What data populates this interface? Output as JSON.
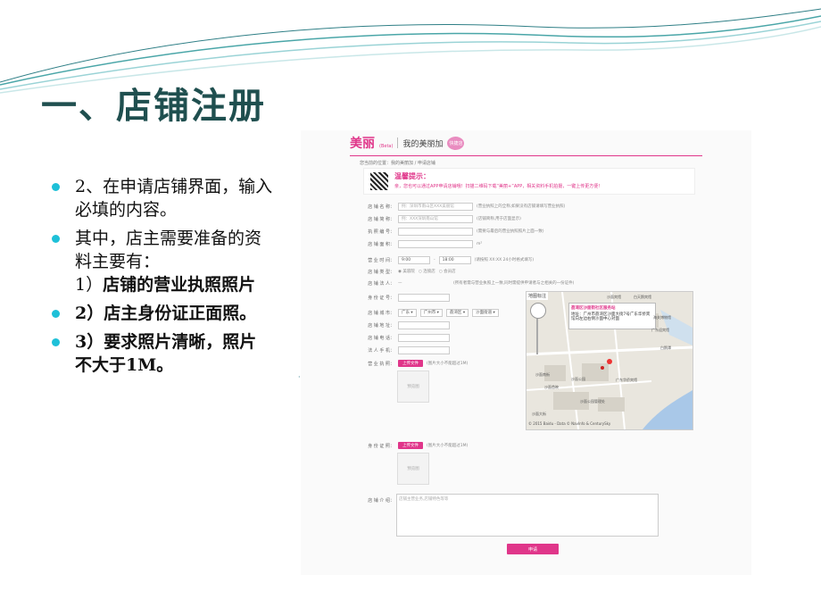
{
  "slide": {
    "title": "一、店铺注册",
    "bullets": [
      {
        "text": "2、在申请店铺界面，输入必填的内容。",
        "bold": false
      },
      {
        "text": "其中，店主需要准备的资料主要有：",
        "bold": false,
        "extra": "1）",
        "extra_bold": "店铺的营业执照照片"
      },
      {
        "text": "2）店主身份证正面照。",
        "bold": true
      },
      {
        "text": "3）要求照片清晰，照片不大于1M。",
        "bold": true
      }
    ],
    "colors": {
      "title": "#1f4f4f",
      "bullet_dot": "#1ec0d8",
      "accent": "#e0368a"
    }
  },
  "screenshot": {
    "logo": "美丽",
    "logo_sub": "(Beta)",
    "page_title": "我的美丽加",
    "tag": "快捷店",
    "breadcrumb": "您当前的位置：我的美丽加 / 申请店铺",
    "tip_title": "温馨提示：",
    "tip_text": "亲，您也可以通过APP申请店铺哦！扫描二维码下载“美丽+”APP，相关资料手机拍摄，一键上传更方便！",
    "fields": [
      {
        "label": "店 铺 名 称：",
        "placeholder": "例：深圳市南山区XXX美丽馆",
        "note": "(营业执照上的全称,如果没有店铺请填写营业执照)"
      },
      {
        "label": "店 铺 简 称：",
        "placeholder": "例：XXX深圳南山馆",
        "note": "(店铺简称,用于店面显示)"
      },
      {
        "label": "执 照 编 号：",
        "placeholder": "",
        "note": "(需要与最后的营业执照照片上面一致)"
      },
      {
        "label": "店 铺 面 积：",
        "placeholder": "",
        "note": "m²"
      },
      {
        "label": "营 业 时 间：",
        "placeholder": "",
        "note": "(请按照 XX:XX 24小时格式填写)"
      },
      {
        "label": "店 铺 类 型：",
        "placeholder": "",
        "note": ""
      },
      {
        "label": "店 铺 法 人：",
        "placeholder": "",
        "note": "(所有者需与营业执照上一致,同时需提供申请者与之相关的一份证件)"
      },
      {
        "label": "身 份 证 号：",
        "placeholder": "",
        "note": ""
      },
      {
        "label": "店 铺 城 市：",
        "placeholder": "",
        "note": ""
      },
      {
        "label": "店 铺 地 址：",
        "placeholder": "",
        "note": ""
      },
      {
        "label": "店 铺 电 话：",
        "placeholder": "",
        "note": ""
      },
      {
        "label": "法 人 手 机：",
        "placeholder": "",
        "note": ""
      }
    ],
    "time_from": "9:00",
    "time_to": "18:00",
    "shop_types": [
      "美容院",
      "连锁店",
      "会员店"
    ],
    "shop_type_selected": "美容院",
    "city_selects": [
      "广东",
      "广州市",
      "荔湾区",
      "沙面街道"
    ],
    "map_label": "地图标注",
    "map_popup_title": "荔湾区沙面街社区服务站",
    "map_popup_addr": "地址：广州市荔湾区沙面大街7号广东华侨宾馆向左边右侧沙面中心对面",
    "map_places": [
      "沙面宾馆",
      "白天鹅宾馆",
      "海关博物馆",
      "沙面公园",
      "沙面公园管理处",
      "沙面南街",
      "白鹅潭",
      "广东华侨宾馆",
      "沙面首映",
      "沙面大街",
      "广东迎宾馆"
    ],
    "map_credit": "© 2015 Baidu - Data © NavInfo & CenturySky",
    "license_label": "营 业 执 照：",
    "id_label": "身 份 证 照：",
    "upload_btn": "上传文件",
    "upload_note": "(图片大小不能超过1M)",
    "preview_text": "预览图",
    "intro_label": "店 铺 介 绍：",
    "intro_placeholder": "店铺主营业务,店铺特色等等",
    "submit_label": "申请"
  }
}
